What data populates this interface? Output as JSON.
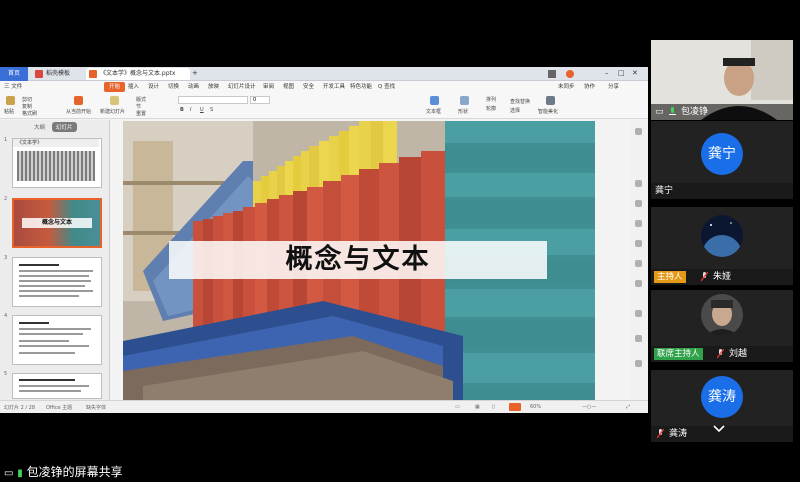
{
  "window": {
    "home_tab": "首页",
    "tabs": [
      {
        "label": "稻壳模板",
        "color": "#d9463b"
      },
      {
        "label": "《文本学》概念与文本.pptx",
        "color": "#e8622c"
      }
    ]
  },
  "menu": {
    "file": "三 文件",
    "items": [
      "开始",
      "插入",
      "设计",
      "切换",
      "动画",
      "放映",
      "幻灯片设计",
      "审阅",
      "视图",
      "安全",
      "开发工具",
      "特色功能"
    ],
    "search": "Q 查找",
    "right": [
      "未同步",
      "协作",
      "分享"
    ]
  },
  "ribbon": {
    "paste": "粘贴",
    "cut": "剪切",
    "copy": "复制",
    "format": "格式刷",
    "from_current": "从当前开始",
    "new_slide": "新建幻灯片",
    "layout": "版式",
    "section": "节",
    "reset": "重置",
    "font_size_value": "0",
    "text_box": "文本框",
    "shapes": "形状",
    "arrange": "排列",
    "outline": "轮廓",
    "find_replace": "查找替换",
    "select": "选择",
    "beautify": "智能美化"
  },
  "panel": {
    "tabs": [
      "大纲",
      "幻灯片"
    ],
    "slide_numbers": [
      "1",
      "2",
      "3",
      "4",
      "5"
    ],
    "thumb1_title": "《文本学》",
    "thumb2_title": "概念与文本"
  },
  "slide": {
    "title": "概念与文本"
  },
  "status": {
    "slide_info": "幻灯片 2 / 28",
    "theme": "Office 主题",
    "notes": "缺失字体",
    "zoom": "60%"
  },
  "participants": [
    {
      "name": "包凌铮",
      "role": ""
    },
    {
      "name": "龚宁",
      "role": "",
      "avatar_text": "龚宁"
    },
    {
      "name": "朱娅",
      "role": "主持人"
    },
    {
      "name": "刘越",
      "role": "联席主持人"
    },
    {
      "name": "龚涛",
      "role": "",
      "avatar_text": "龚涛"
    }
  ],
  "share_label": "包凌铮的屏幕共享",
  "colors": {
    "accent_orange": "#e8622c",
    "host_role": "#e39b17",
    "cohost_role": "#2fa24a",
    "avatar_blue": "#1a6fe8"
  }
}
